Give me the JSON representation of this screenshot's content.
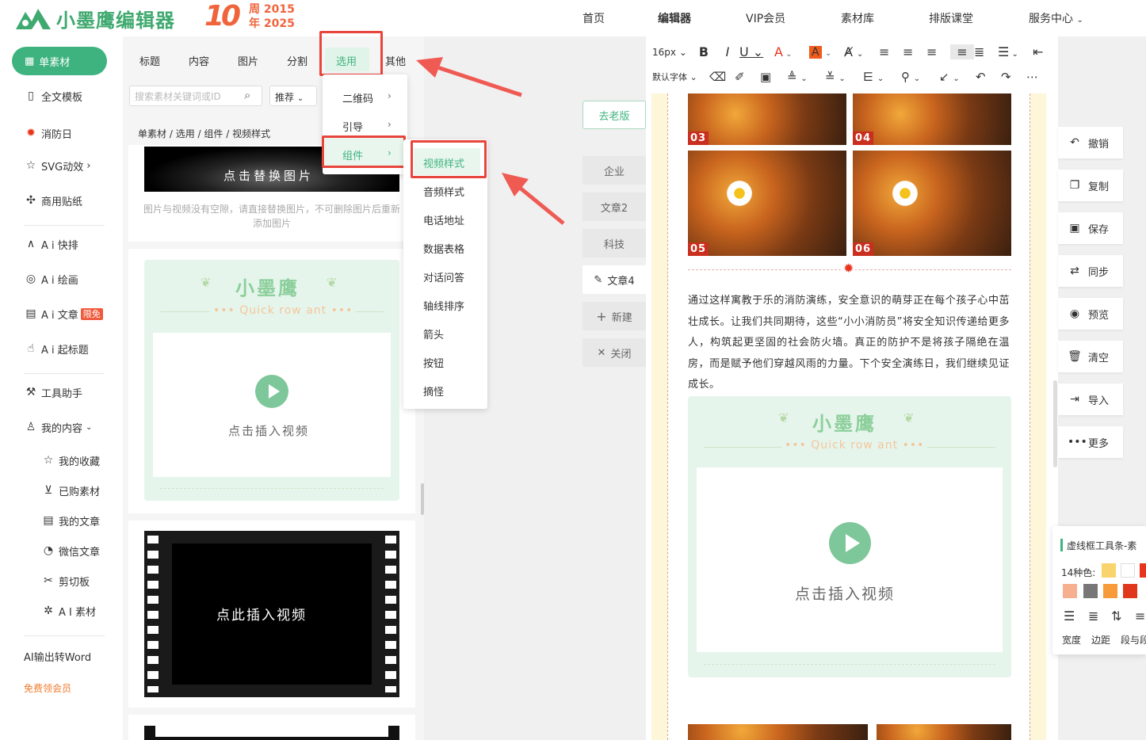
{
  "brand": {
    "name": "小墨鹰编辑器",
    "anniv_number": "10",
    "anniv_line1": "周 2015",
    "anniv_line2": "年 2025",
    "accent": "#3fb37f"
  },
  "nav": [
    "首页",
    "编辑器",
    "VIP会员",
    "素材库",
    "排版课堂",
    "服务中心"
  ],
  "sidebar": {
    "active": "单素材",
    "items": [
      "全文模板",
      "消防日",
      "SVG动效",
      "商用贴纸",
      "A i 快排",
      "A i 绘画",
      "A i 文章",
      "A i 起标题",
      "工具助手",
      "我的内容",
      "我的收藏",
      "已购素材",
      "我的文章",
      "微信文章",
      "剪切板",
      "A I 素材",
      "AI输出转Word",
      "免费领会员"
    ],
    "badge": "限免"
  },
  "tabs": [
    "标题",
    "内容",
    "图片",
    "分割",
    "选用",
    "其他"
  ],
  "search": {
    "placeholder": "搜索素材关键词或ID",
    "sort": "推荐"
  },
  "breadcrumb": [
    "单素材",
    "选用",
    "组件",
    "视频样式"
  ],
  "dropdown": [
    "二维码",
    "引导",
    "组件"
  ],
  "submenu": [
    "视频样式",
    "音频样式",
    "电话地址",
    "数据表格",
    "对话问答",
    "轴线排序",
    "箭头",
    "按钮",
    "摘怪"
  ],
  "cards": {
    "replace_text": "点击替换图片",
    "note": "图片与视频没有空隙，请直接替换图片，不可删除图片后重新添加图片",
    "title": "小墨鹰",
    "subtitle": "Quick row ant",
    "insert_video": "点击插入视频",
    "film_text": "点此插入视频"
  },
  "mid": {
    "old_version": "去老版",
    "tabs": [
      "企业",
      "文章2",
      "科技",
      "文章4",
      "新建",
      "关闭"
    ]
  },
  "toolbar": {
    "font_size": "16px",
    "font_family": "默认字体"
  },
  "article": {
    "photo_nums": [
      "03",
      "04",
      "05",
      "06"
    ],
    "paragraph": "通过这样寓教于乐的消防演练，安全意识的萌芽正在每个孩子心中茁壮成长。让我们共同期待，这些“小小消防员”将安全知识传递给更多人，构筑起更坚固的社会防火墙。真正的防护不是将孩子隔绝在温房，而是赋予他们穿越风雨的力量。下个安全演练日，我们继续见证成长。"
  },
  "right_actions": [
    "撤销",
    "复制",
    "保存",
    "同步",
    "预览",
    "清空",
    "导入",
    "更多"
  ],
  "float_panel": {
    "title": "虚线框工具条-素",
    "colors_label": "14种色:",
    "labels": [
      "宽度",
      "边距",
      "段与段"
    ],
    "colors": [
      "#f9d36b",
      "#ffffff",
      "#e8341c",
      "#f6b08e",
      "#777777",
      "#f79a3a",
      "#e0361c"
    ]
  }
}
